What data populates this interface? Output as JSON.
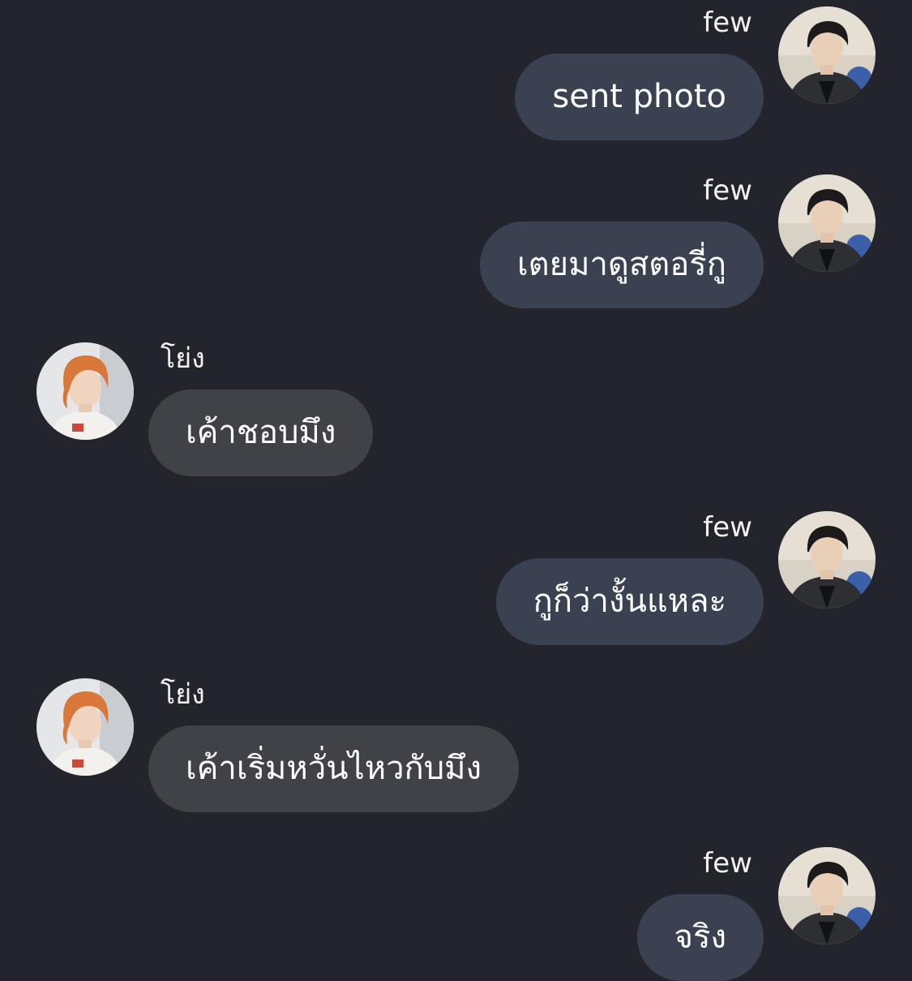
{
  "colors": {
    "background": "#23242c",
    "outgoing_bubble": "#3a4252",
    "incoming_bubble": "#414148",
    "text": "#ffffff"
  },
  "messages": [
    {
      "direction": "outgoing",
      "sender": "few",
      "text": "sent photo",
      "avatar": "avatar-few-icon"
    },
    {
      "direction": "outgoing",
      "sender": "few",
      "text": "เตยมาดูสตอรี่กู",
      "avatar": "avatar-few-icon"
    },
    {
      "direction": "incoming",
      "sender": "โย่ง",
      "text": "เค้าชอบมึง",
      "avatar": "avatar-yong-icon"
    },
    {
      "direction": "outgoing",
      "sender": "few",
      "text": "กูก็ว่างั้นแหละ",
      "avatar": "avatar-few-icon"
    },
    {
      "direction": "incoming",
      "sender": "โย่ง",
      "text": "เค้าเริ่มหวั่นไหวกับมึง",
      "avatar": "avatar-yong-icon"
    },
    {
      "direction": "outgoing",
      "sender": "few",
      "text": "จริง",
      "avatar": "avatar-few-icon"
    }
  ]
}
